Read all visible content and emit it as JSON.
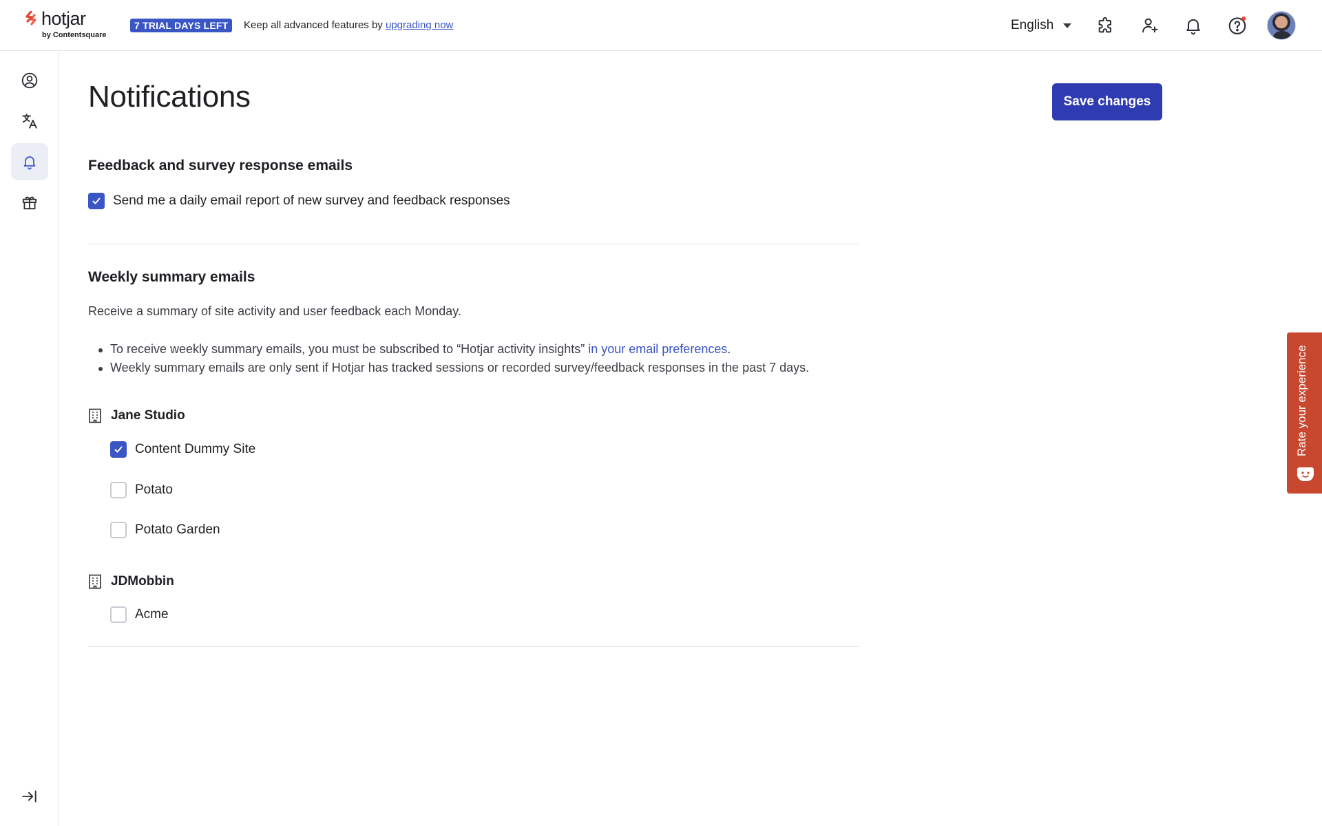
{
  "header": {
    "logo_text": "hotjar",
    "logo_subtext": "by Contentsquare",
    "trial_badge": "7 TRIAL DAYS LEFT",
    "trial_message": "Keep all advanced features by ",
    "trial_link": "upgrading now",
    "language": "English",
    "icons": [
      "integrations-icon",
      "invite-user-icon",
      "notifications-icon",
      "help-icon",
      "avatar"
    ]
  },
  "sidebar": {
    "items": [
      {
        "icon": "account-icon"
      },
      {
        "icon": "language-icon"
      },
      {
        "icon": "bell-icon",
        "active": true
      },
      {
        "icon": "gift-icon"
      }
    ],
    "bottom_icon": "collapse-sidebar-icon"
  },
  "main": {
    "title": "Notifications",
    "save_label": "Save changes",
    "feedback_section": {
      "title": "Feedback and survey response emails",
      "daily_report_label": "Send me a daily email report of new survey and feedback responses",
      "daily_report_checked": true
    },
    "weekly_section": {
      "title": "Weekly summary emails",
      "description": "Receive a summary of site activity and user feedback each Monday.",
      "bullet1_text": "To receive weekly summary emails, you must be subscribed to “Hotjar activity insights” ",
      "bullet1_link": "in your email preferences",
      "bullet1_end": ".",
      "bullet2_text": "Weekly summary emails are only sent if Hotjar has tracked sessions or recorded survey/feedback responses in the past 7 days.",
      "organizations": [
        {
          "name": "Jane Studio",
          "sites": [
            {
              "name": "Content Dummy Site",
              "checked": true
            },
            {
              "name": "Potato",
              "checked": false
            },
            {
              "name": "Potato Garden",
              "checked": false
            }
          ]
        },
        {
          "name": "JDMobbin",
          "sites": [
            {
              "name": "Acme",
              "checked": false
            }
          ]
        }
      ]
    }
  },
  "feedback_tab": {
    "label": "Rate your experience"
  },
  "colors": {
    "brand_blue": "#2e3bb1",
    "checkbox_blue": "#3a55c4",
    "rate_tab": "#c8472f",
    "logo_red": "#e5442f"
  }
}
